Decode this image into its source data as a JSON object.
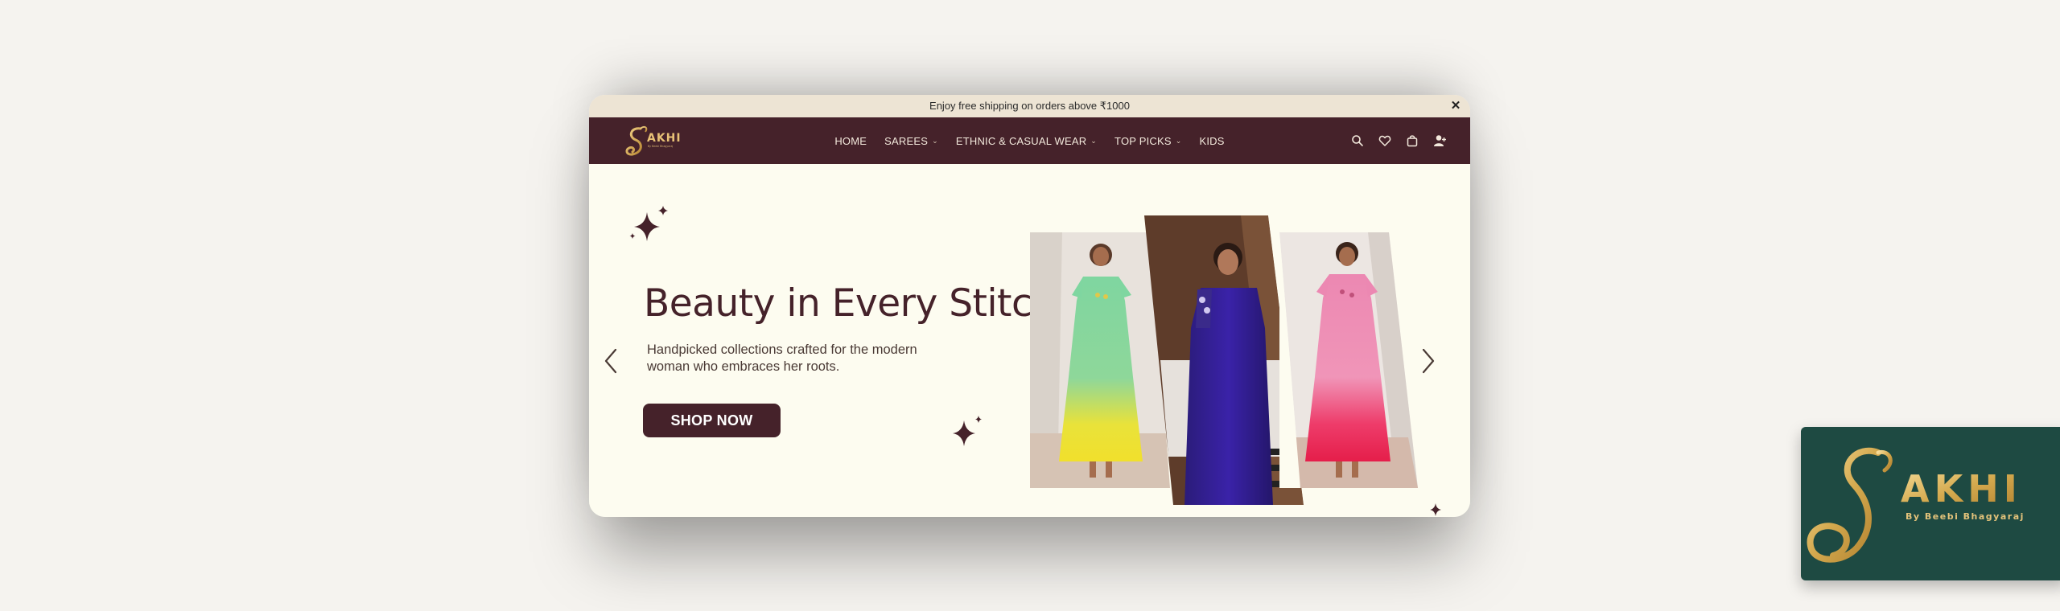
{
  "announcement": {
    "text": "Enjoy free shipping on orders above ₹1000",
    "close_label": "✕"
  },
  "nav": {
    "logo_text": "AKHI",
    "logo_tagline": "By Beebi Bhagyaraj",
    "items": [
      {
        "label": "HOME",
        "has_dropdown": false
      },
      {
        "label": "SAREES",
        "has_dropdown": true
      },
      {
        "label": "ETHNIC & CASUAL WEAR",
        "has_dropdown": true
      },
      {
        "label": "TOP PICKS",
        "has_dropdown": true
      },
      {
        "label": "KIDS",
        "has_dropdown": false
      }
    ],
    "icons": [
      "search-icon",
      "heart-icon",
      "bag-icon",
      "user-icon"
    ]
  },
  "hero": {
    "title": "Beauty in Every Stitch",
    "subtitle": "Handpicked collections crafted for the modern woman who embraces her roots.",
    "cta_label": "SHOP NOW"
  },
  "badge": {
    "logo_text": "AKHI",
    "tagline": "By Beebi Bhagyaraj"
  },
  "colors": {
    "page_bg": "#f5f3ef",
    "announcement_bg": "#ede4d4",
    "nav_bg": "#45222a",
    "hero_bg": "#fdfcf0",
    "accent_gold": "#d4a94e",
    "badge_bg": "#1e4a42"
  }
}
